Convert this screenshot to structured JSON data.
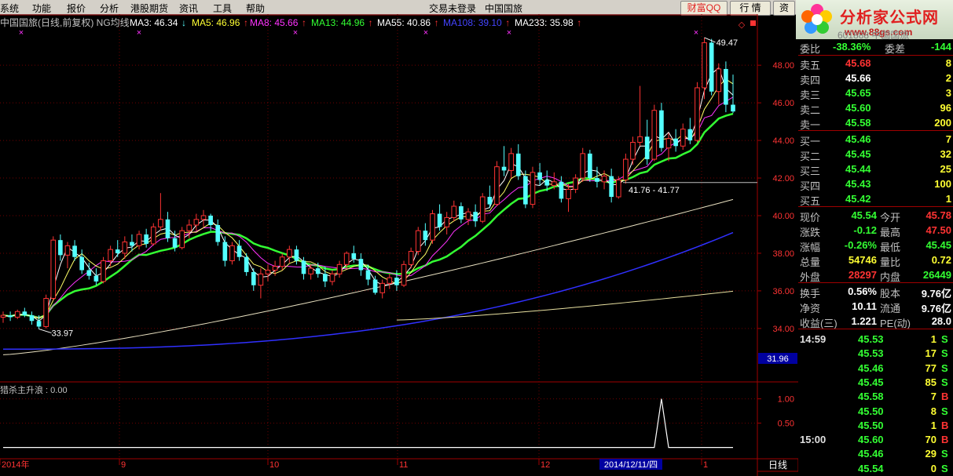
{
  "menu": {
    "items": [
      "系统",
      "功能",
      "报价",
      "分析",
      "港股期货",
      "资讯",
      "工具",
      "帮助"
    ],
    "status": "交易未登录",
    "stock_name": "中国国旅"
  },
  "toolbar": {
    "caifu": "财富QQ",
    "hangqing": "行 情",
    "zi": "资"
  },
  "logo": {
    "title": "分析家公式网",
    "url": "www.88gs.com"
  },
  "chart_data": [
    {
      "type": "candlestick",
      "title": "中国国旅(日线,前复权) NG均线",
      "legend": [
        {
          "name": "MA3",
          "value": "46.34",
          "color": "#ffffff",
          "arrow": "↓"
        },
        {
          "name": "MA5",
          "value": "46.96",
          "color": "#ffff33",
          "arrow": "↑"
        },
        {
          "name": "MA8",
          "value": "45.66",
          "color": "#ff33ff",
          "arrow": "↑"
        },
        {
          "name": "MA13",
          "value": "44.96",
          "color": "#33ff33",
          "arrow": "↑"
        },
        {
          "name": "MA55",
          "value": "40.86",
          "color": "#ffffff",
          "arrow": "↑"
        },
        {
          "name": "MA108",
          "value": "39.10",
          "color": "#3333ff",
          "arrow": "↑"
        },
        {
          "name": "MA233",
          "value": "35.98",
          "color": "#ffffff",
          "arrow": "↑"
        }
      ],
      "y_ticks": [
        34.0,
        36.0,
        38.0,
        40.0,
        42.0,
        44.0,
        46.0,
        48.0
      ],
      "ylim": [
        31.2,
        49.8
      ],
      "x_labels": [
        "2014年",
        "9",
        "10",
        "11",
        "12",
        "1"
      ],
      "cursor_date": "2014/12/11/四",
      "annotations": {
        "high": "49.47",
        "low": "33.97",
        "range": "41.76 - 41.77",
        "axis_marker": "31.96"
      },
      "ohlc": [
        [
          34.6,
          34.9,
          34.3,
          34.7
        ],
        [
          34.7,
          34.9,
          34.4,
          34.6
        ],
        [
          34.6,
          35.0,
          34.5,
          34.9
        ],
        [
          34.9,
          35.1,
          34.6,
          34.7
        ],
        [
          34.7,
          34.9,
          34.2,
          34.4
        ],
        [
          34.4,
          34.7,
          33.97,
          34.1
        ],
        [
          34.1,
          35.8,
          34.0,
          35.6
        ],
        [
          35.6,
          38.9,
          35.5,
          38.7
        ],
        [
          38.7,
          39.0,
          37.6,
          37.9
        ],
        [
          37.9,
          38.6,
          37.2,
          38.4
        ],
        [
          38.4,
          38.7,
          37.6,
          37.8
        ],
        [
          37.8,
          38.2,
          36.9,
          37.1
        ],
        [
          37.1,
          37.5,
          36.6,
          36.8
        ],
        [
          36.8,
          37.2,
          36.3,
          36.5
        ],
        [
          36.5,
          37.8,
          36.4,
          37.6
        ],
        [
          37.6,
          38.4,
          37.3,
          38.2
        ],
        [
          38.2,
          38.7,
          37.8,
          38.0
        ],
        [
          38.0,
          38.9,
          37.7,
          38.6
        ],
        [
          38.6,
          39.0,
          38.1,
          38.4
        ],
        [
          38.4,
          39.2,
          38.2,
          39.0
        ],
        [
          39.0,
          39.3,
          38.3,
          38.5
        ],
        [
          38.5,
          39.6,
          38.4,
          39.4
        ],
        [
          39.4,
          41.2,
          39.2,
          39.8
        ],
        [
          39.8,
          40.2,
          38.6,
          38.8
        ],
        [
          38.8,
          39.2,
          38.1,
          38.3
        ],
        [
          38.3,
          39.4,
          38.2,
          39.2
        ],
        [
          39.2,
          39.8,
          38.8,
          39.5
        ],
        [
          39.5,
          40.1,
          39.2,
          39.8
        ],
        [
          39.8,
          40.3,
          39.4,
          40.0
        ],
        [
          40.0,
          40.1,
          39.2,
          39.5
        ],
        [
          39.5,
          39.8,
          38.4,
          38.6
        ],
        [
          38.6,
          38.9,
          37.3,
          37.6
        ],
        [
          37.6,
          38.6,
          37.4,
          38.4
        ],
        [
          38.4,
          38.7,
          37.6,
          37.8
        ],
        [
          37.8,
          38.0,
          36.8,
          37.0
        ],
        [
          37.0,
          37.2,
          36.0,
          36.3
        ],
        [
          36.3,
          37.2,
          35.6,
          36.9
        ],
        [
          36.9,
          37.4,
          36.5,
          37.1
        ],
        [
          37.1,
          37.6,
          36.8,
          37.3
        ],
        [
          37.3,
          38.0,
          37.1,
          37.8
        ],
        [
          37.8,
          38.4,
          37.5,
          38.2
        ],
        [
          38.2,
          38.4,
          37.4,
          37.6
        ],
        [
          37.6,
          37.8,
          36.6,
          36.9
        ],
        [
          36.9,
          37.4,
          36.6,
          37.2
        ],
        [
          37.2,
          37.5,
          36.7,
          36.9
        ],
        [
          36.9,
          37.3,
          36.2,
          36.5
        ],
        [
          36.5,
          37.1,
          36.3,
          36.9
        ],
        [
          36.9,
          37.6,
          36.7,
          37.4
        ],
        [
          37.4,
          38.1,
          37.2,
          38.0
        ],
        [
          38.0,
          38.4,
          37.5,
          37.7
        ],
        [
          37.7,
          38.0,
          36.8,
          37.1
        ],
        [
          37.1,
          37.4,
          36.3,
          36.6
        ],
        [
          36.6,
          36.8,
          35.8,
          35.9
        ],
        [
          35.9,
          36.6,
          35.6,
          36.4
        ],
        [
          36.4,
          36.9,
          36.1,
          36.7
        ],
        [
          36.7,
          37.1,
          36.0,
          36.3
        ],
        [
          36.3,
          37.6,
          36.2,
          37.4
        ],
        [
          37.4,
          38.3,
          37.2,
          38.1
        ],
        [
          38.1,
          39.4,
          37.9,
          39.2
        ],
        [
          39.2,
          39.6,
          38.4,
          38.7
        ],
        [
          38.7,
          40.3,
          38.5,
          40.1
        ],
        [
          40.1,
          40.6,
          39.2,
          39.4
        ],
        [
          39.4,
          40.2,
          39.0,
          39.9
        ],
        [
          39.9,
          40.8,
          39.7,
          40.5
        ],
        [
          40.5,
          40.7,
          39.6,
          39.8
        ],
        [
          39.8,
          40.4,
          39.5,
          40.2
        ],
        [
          40.2,
          40.6,
          39.4,
          39.7
        ],
        [
          39.7,
          41.2,
          39.6,
          41.0
        ],
        [
          41.0,
          41.6,
          40.4,
          40.6
        ],
        [
          40.6,
          42.9,
          40.5,
          42.6
        ],
        [
          42.6,
          43.7,
          42.1,
          42.4
        ],
        [
          42.4,
          43.6,
          42.0,
          43.3
        ],
        [
          43.3,
          43.8,
          41.9,
          42.1
        ],
        [
          42.1,
          42.4,
          40.4,
          40.6
        ],
        [
          40.6,
          42.6,
          40.4,
          42.3
        ],
        [
          42.3,
          42.8,
          41.6,
          41.9
        ],
        [
          41.9,
          42.4,
          41.3,
          41.6
        ],
        [
          41.6,
          42.3,
          41.4,
          41.8
        ],
        [
          41.8,
          42.1,
          40.7,
          40.9
        ],
        [
          40.9,
          41.7,
          40.2,
          41.4
        ],
        [
          41.4,
          42.2,
          41.2,
          42.0
        ],
        [
          42.0,
          43.6,
          41.8,
          43.3
        ],
        [
          43.3,
          43.5,
          41.8,
          42.0
        ],
        [
          42.0,
          42.6,
          41.5,
          41.8
        ],
        [
          41.8,
          42.4,
          41.4,
          42.1
        ],
        [
          42.1,
          42.5,
          40.7,
          41.0
        ],
        [
          41.0,
          42.1,
          40.9,
          41.9
        ],
        [
          41.9,
          43.3,
          41.7,
          43.0
        ],
        [
          43.0,
          44.2,
          42.7,
          43.9
        ],
        [
          43.9,
          46.9,
          43.7,
          44.2
        ],
        [
          44.2,
          45.1,
          42.7,
          43.0
        ],
        [
          43.0,
          45.9,
          42.9,
          45.6
        ],
        [
          45.6,
          46.0,
          43.4,
          43.6
        ],
        [
          43.6,
          44.4,
          42.9,
          44.1
        ],
        [
          44.1,
          44.6,
          43.4,
          43.7
        ],
        [
          43.7,
          44.9,
          43.5,
          44.6
        ],
        [
          44.6,
          45.2,
          43.8,
          44.0
        ],
        [
          44.0,
          47.1,
          43.9,
          46.8
        ],
        [
          46.8,
          49.47,
          46.2,
          49.2
        ],
        [
          49.2,
          49.4,
          46.4,
          46.6
        ],
        [
          46.6,
          48.1,
          45.9,
          47.8
        ],
        [
          47.8,
          48.2,
          45.5,
          45.9
        ],
        [
          45.9,
          47.5,
          45.45,
          45.54
        ]
      ]
    },
    {
      "type": "line",
      "indicator_label": "猎杀主升浪 : 0.00",
      "y_ticks": [
        0.5,
        1.0
      ],
      "ylim": [
        -0.2,
        1.3
      ],
      "spike_index": 92
    }
  ],
  "quote": {
    "code_name": "601888 中国国旅",
    "webi": {
      "label": "委比",
      "value": "-38.36%",
      "diff_label": "委差",
      "diff": "-144"
    },
    "sells": [
      {
        "label": "卖五",
        "price": "45.68",
        "vol": "8",
        "color": "r"
      },
      {
        "label": "卖四",
        "price": "45.66",
        "vol": "2",
        "color": "w"
      },
      {
        "label": "卖三",
        "price": "45.65",
        "vol": "3",
        "color": "g"
      },
      {
        "label": "卖二",
        "price": "45.60",
        "vol": "96",
        "color": "g"
      },
      {
        "label": "卖一",
        "price": "45.58",
        "vol": "200",
        "color": "g"
      }
    ],
    "buys": [
      {
        "label": "买一",
        "price": "45.46",
        "vol": "7",
        "color": "g"
      },
      {
        "label": "买二",
        "price": "45.45",
        "vol": "32",
        "color": "g"
      },
      {
        "label": "买三",
        "price": "45.44",
        "vol": "25",
        "color": "g"
      },
      {
        "label": "买四",
        "price": "45.43",
        "vol": "100",
        "color": "g"
      },
      {
        "label": "买五",
        "price": "45.42",
        "vol": "1",
        "color": "g"
      }
    ],
    "stats": [
      [
        {
          "l": "现价",
          "v": "45.54",
          "c": "g"
        },
        {
          "l": "今开",
          "v": "45.78",
          "c": "r"
        }
      ],
      [
        {
          "l": "涨跌",
          "v": "-0.12",
          "c": "g"
        },
        {
          "l": "最高",
          "v": "47.50",
          "c": "r"
        }
      ],
      [
        {
          "l": "涨幅",
          "v": "-0.26%",
          "c": "g"
        },
        {
          "l": "最低",
          "v": "45.45",
          "c": "g"
        }
      ],
      [
        {
          "l": "总量",
          "v": "54746",
          "c": "y"
        },
        {
          "l": "量比",
          "v": "0.72",
          "c": "y"
        }
      ],
      [
        {
          "l": "外盘",
          "v": "28297",
          "c": "r"
        },
        {
          "l": "内盘",
          "v": "26449",
          "c": "g"
        }
      ],
      [
        {
          "l": "换手",
          "v": "0.56%",
          "c": "w"
        },
        {
          "l": "股本",
          "v": "9.76亿",
          "c": "w"
        }
      ],
      [
        {
          "l": "净资",
          "v": "10.11",
          "c": "w"
        },
        {
          "l": "流通",
          "v": "9.76亿",
          "c": "w"
        }
      ],
      [
        {
          "l": "收益(三)",
          "v": "1.221",
          "c": "w"
        },
        {
          "l": "PE(动)",
          "v": "28.0",
          "c": "w"
        }
      ]
    ],
    "ticks": [
      {
        "time": "14:59",
        "price": "45.53",
        "vol": "1",
        "side": "S"
      },
      {
        "time": "",
        "price": "45.53",
        "vol": "17",
        "side": "S"
      },
      {
        "time": "",
        "price": "45.46",
        "vol": "77",
        "side": "S"
      },
      {
        "time": "",
        "price": "45.45",
        "vol": "85",
        "side": "S"
      },
      {
        "time": "",
        "price": "45.58",
        "vol": "7",
        "side": "B"
      },
      {
        "time": "",
        "price": "45.50",
        "vol": "8",
        "side": "S"
      },
      {
        "time": "",
        "price": "45.50",
        "vol": "1",
        "side": "B"
      },
      {
        "time": "15:00",
        "price": "45.60",
        "vol": "70",
        "side": "B"
      },
      {
        "time": "",
        "price": "45.46",
        "vol": "29",
        "side": "S"
      },
      {
        "time": "",
        "price": "45.54",
        "vol": "0",
        "side": "S"
      }
    ],
    "period_label": "日线"
  }
}
